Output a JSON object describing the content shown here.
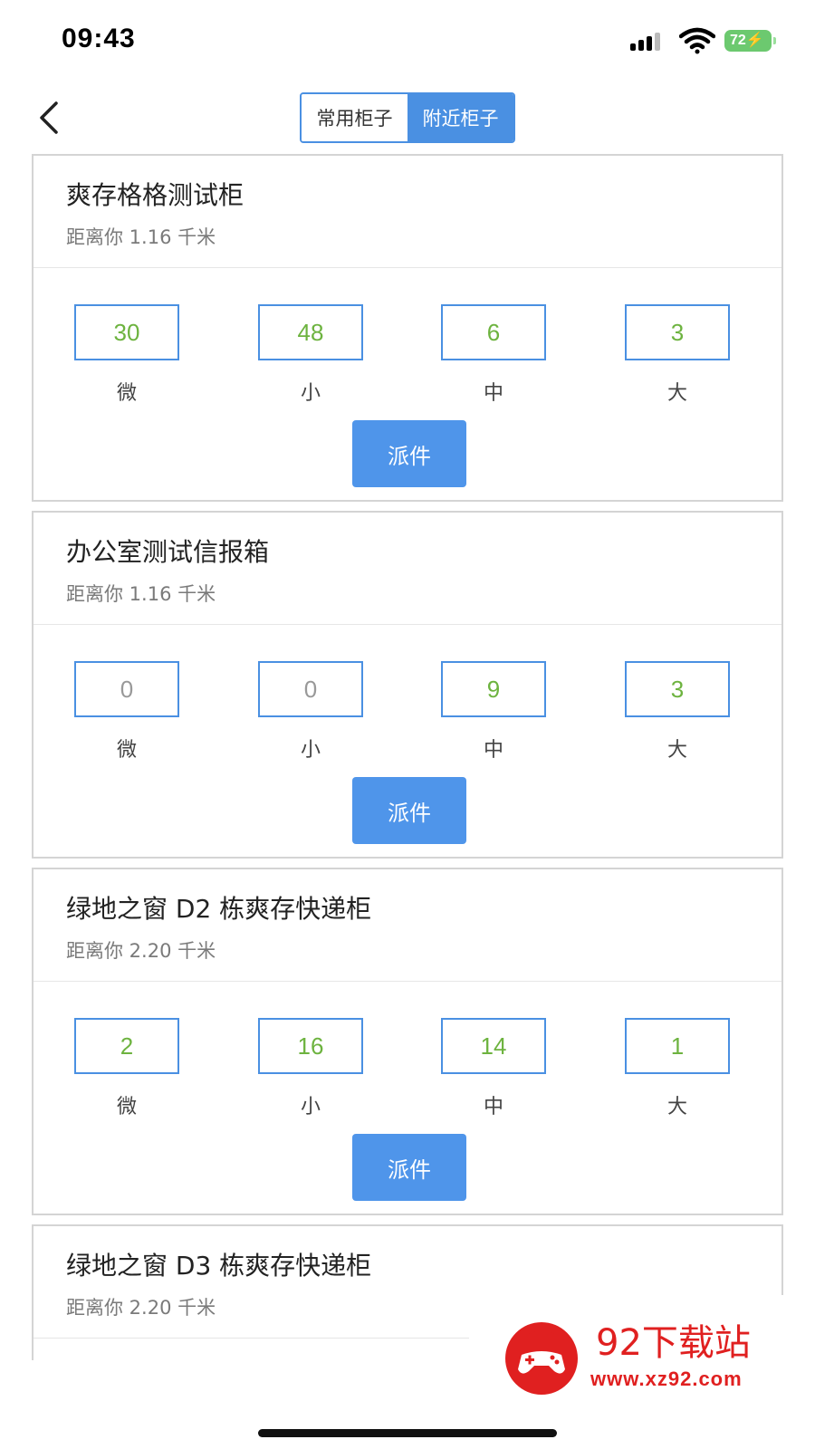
{
  "status_bar": {
    "time": "09:43",
    "battery": "72"
  },
  "nav": {
    "tabs": [
      {
        "label": "常用柜子",
        "active": false
      },
      {
        "label": "附近柜子",
        "active": true
      }
    ]
  },
  "size_labels": [
    "微",
    "小",
    "中",
    "大"
  ],
  "dispatch_label": "派件",
  "cabinets": [
    {
      "name": "爽存格格测试柜",
      "distance": "距离你 1.16 千米",
      "counts": [
        "30",
        "48",
        "6",
        "3"
      ]
    },
    {
      "name": "办公室测试信报箱",
      "distance": "距离你 1.16 千米",
      "counts": [
        "0",
        "0",
        "9",
        "3"
      ]
    },
    {
      "name": "绿地之窗 D2 栋爽存快递柜",
      "distance": "距离你 2.20 千米",
      "counts": [
        "2",
        "16",
        "14",
        "1"
      ]
    },
    {
      "name": "绿地之窗 D3 栋爽存快递柜",
      "distance": "距离你 2.20 千米"
    }
  ],
  "watermark": {
    "title": "92下载站",
    "url": "www.xz92.com"
  },
  "colors": {
    "accent": "#4a90e2",
    "available": "#6db33f",
    "empty": "#999999",
    "watermark": "#e02020"
  }
}
